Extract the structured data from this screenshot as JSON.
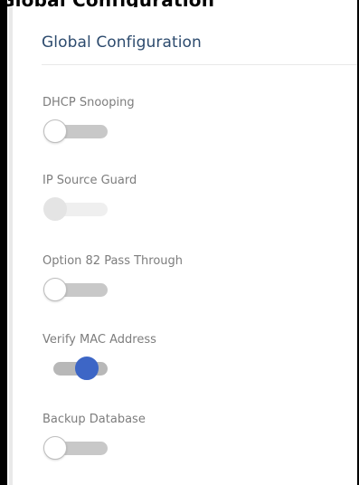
{
  "header_cut_text": "Global Configuration",
  "panel": {
    "title": "Global Configuration"
  },
  "settings": [
    {
      "label": "DHCP Snooping",
      "state": "off",
      "enabled": true
    },
    {
      "label": "IP Source Guard",
      "state": "off",
      "enabled": false
    },
    {
      "label": "Option 82 Pass Through",
      "state": "off",
      "enabled": true
    },
    {
      "label": "Verify MAC Address",
      "state": "on",
      "enabled": true
    },
    {
      "label": "Backup Database",
      "state": "off",
      "enabled": true
    }
  ],
  "colors": {
    "title": "#2d4b6e",
    "label": "#7d7d7d",
    "toggle_on": "#3d66c6",
    "toggle_off_track": "#c8c8c8",
    "toggle_disabled": "#efefef"
  }
}
